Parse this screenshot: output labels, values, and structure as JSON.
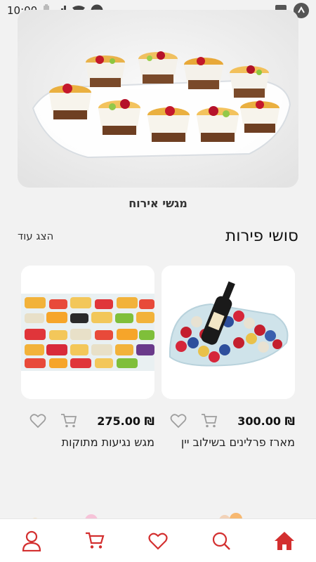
{
  "status_bar": {
    "time": "10:00",
    "icons": [
      "battery-icon",
      "signal-icon",
      "wifi-icon",
      "dnd-icon",
      "image-icon",
      "app-badge-icon"
    ]
  },
  "hero_category": {
    "label": "מגשי אירוח",
    "image": "fruit-yogurt-cups-tray"
  },
  "section": {
    "title": "סושי פירות",
    "show_more": "הצג עוד"
  },
  "products": [
    {
      "name": "מארז פרלינים בשילוב יין",
      "price": "300.00 ₪",
      "image": "wine-and-candies-platter"
    },
    {
      "name": "מגש נגיעות מתוקות",
      "price": "275.00 ₪",
      "image": "fruit-skewers-platter"
    }
  ],
  "bottom_nav": {
    "items": [
      "home-icon",
      "search-icon",
      "heart-icon",
      "cart-icon",
      "user-icon"
    ]
  },
  "colors": {
    "accent": "#d32f2f",
    "background": "#f2f2f2",
    "icon_gray": "#9e9e9e"
  }
}
